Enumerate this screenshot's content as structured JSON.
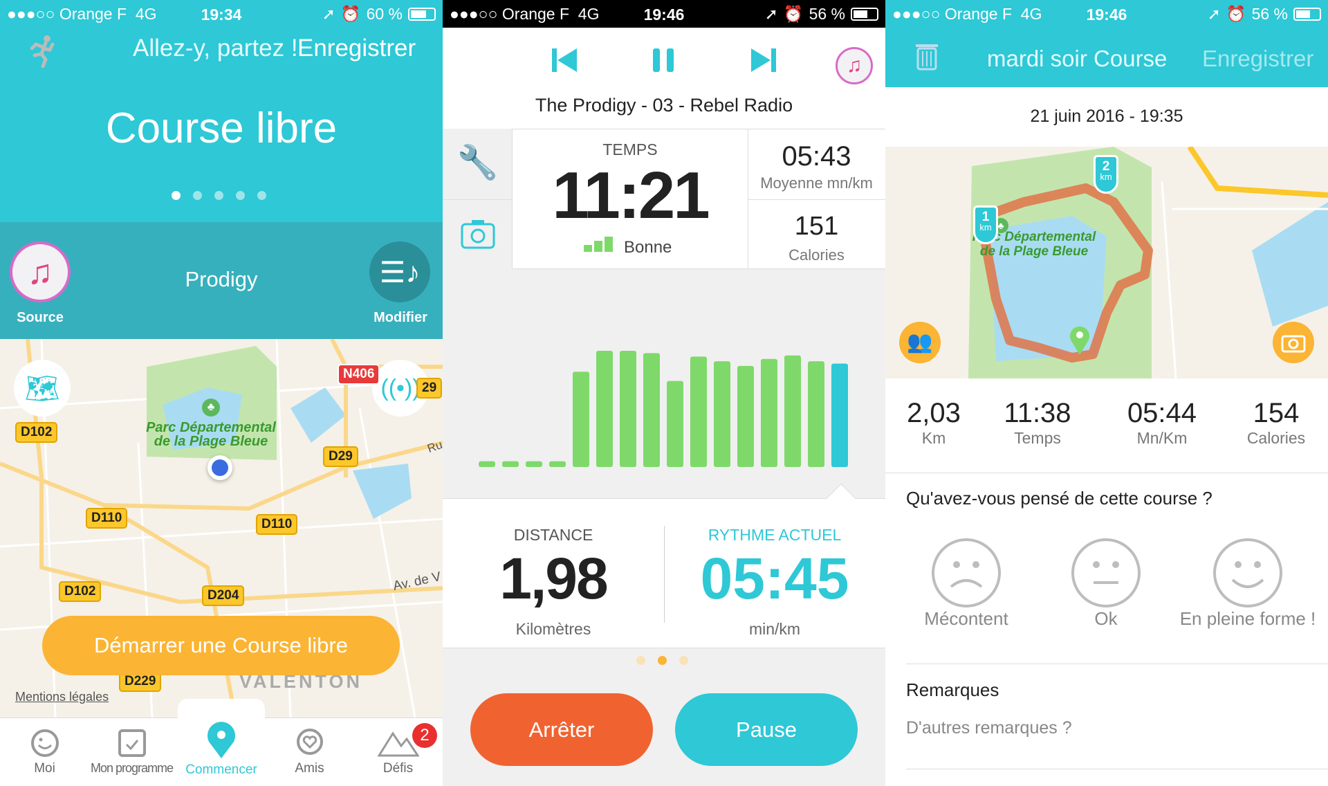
{
  "colors": {
    "teal": "#2ec8d6",
    "teal_dark": "#37b0bd",
    "orange": "#fbb433",
    "red": "#f06331",
    "green": "#7ed96a"
  },
  "panel1": {
    "status": {
      "carrier": "●●●○○ Orange F",
      "network": "4G",
      "time": "19:34",
      "battery": "60 %",
      "battery_level": 0.6
    },
    "header": {
      "subtitle": "Allez-y, partez !",
      "save": "Enregistrer",
      "title": "Course libre",
      "page_count": 5,
      "page_active": 0
    },
    "music": {
      "source_label": "Source",
      "playlist": "Prodigy",
      "edit_label": "Modifier"
    },
    "map": {
      "park_name": "Parc Départemental",
      "park_name2": "de la Plage Bleue",
      "roads": [
        "D102",
        "D110",
        "D110",
        "D29",
        "N406",
        "D102",
        "D204",
        "D229",
        "29"
      ],
      "street": "Av. de V",
      "street2": "Ru",
      "town": "VALENTON",
      "legal": "Mentions légales"
    },
    "start_button": "Démarrer une Course libre",
    "tabs": [
      {
        "label": "Moi",
        "icon": "smiley-icon"
      },
      {
        "label": "Mon programme",
        "icon": "calendar-check-icon"
      },
      {
        "label": "Commencer",
        "icon": "location-pin-icon",
        "active": true
      },
      {
        "label": "Amis",
        "icon": "friends-heart-icon"
      },
      {
        "label": "Défis",
        "icon": "mountain-icon",
        "badge": "2"
      }
    ]
  },
  "panel2": {
    "status": {
      "carrier": "●●●○○ Orange F",
      "network": "4G",
      "time": "19:46",
      "battery": "56 %",
      "battery_level": 0.56
    },
    "song": "The Prodigy - 03 - Rebel Radio",
    "time_label": "TEMPS",
    "time_value": "11:21",
    "signal_label": "Bonne",
    "avg_pace": "05:43",
    "avg_pace_label": "Moyenne mn/km",
    "calories": "151",
    "calories_label": "Calories",
    "pace_bars": {
      "values": [
        0.05,
        0.05,
        0.05,
        0.05,
        0.82,
        1.0,
        1.0,
        0.98,
        0.74,
        0.95,
        0.91,
        0.87,
        0.93,
        0.96,
        0.91,
        0.89
      ],
      "current_index": 15
    },
    "distance_label": "DISTANCE",
    "distance": "1,98",
    "distance_unit": "Kilomètres",
    "pace_label": "RYTHME ACTUEL",
    "pace": "05:45",
    "pace_unit": "min/km",
    "page_count": 3,
    "page_active": 1,
    "stop": "Arrêter",
    "pause": "Pause"
  },
  "panel3": {
    "status": {
      "carrier": "●●●○○ Orange F",
      "network": "4G",
      "time": "19:46",
      "battery": "56 %",
      "battery_level": 0.56
    },
    "title": "mardi soir Course",
    "save": "Enregistrer",
    "date": "21 juin 2016 - 19:35",
    "map": {
      "park_name": "Parc Départemental",
      "park_name2": "de la Plage Bleue",
      "km1": "1",
      "km2": "2",
      "km_unit": "km"
    },
    "stats": [
      {
        "value": "2,03",
        "label": "Km"
      },
      {
        "value": "11:38",
        "label": "Temps"
      },
      {
        "value": "05:44",
        "label": "Mn/Km"
      },
      {
        "value": "154",
        "label": "Calories"
      }
    ],
    "question": "Qu'avez-vous pensé de cette course ?",
    "moods": [
      {
        "label": "Mécontent"
      },
      {
        "label": "Ok"
      },
      {
        "label": "En pleine forme !"
      }
    ],
    "remarks_title": "Remarques",
    "remarks_placeholder": "D'autres remarques ?"
  }
}
